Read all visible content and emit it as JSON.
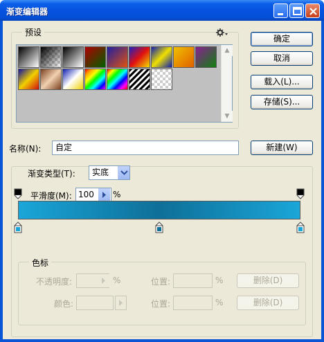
{
  "window": {
    "title": "渐变编辑器"
  },
  "presets": {
    "label": "预设",
    "gear_icon": "gear-icon",
    "swatches": [
      {
        "gradient": "linear-gradient(135deg,#000 0%,#fff 100%)"
      },
      {
        "gradient": "linear-gradient(135deg,#000 0%,rgba(0,0,0,0) 100%)",
        "checker": true
      },
      {
        "gradient": "linear-gradient(135deg,#000 0%,#fff 100%)"
      },
      {
        "gradient": "linear-gradient(135deg,#b00000 0%,#006000 100%)"
      },
      {
        "gradient": "linear-gradient(135deg,#2020a0 0%,#e05010 100%)"
      },
      {
        "gradient": "linear-gradient(135deg,#2020c0 0%,#e01010 50%,#f0e000 100%)"
      },
      {
        "gradient": "linear-gradient(135deg,#1020b0 0%,#f0e000 50%,#1020b0 100%)"
      },
      {
        "gradient": "linear-gradient(135deg,#f0c000 0%,#e06000 100%)"
      },
      {
        "gradient": "linear-gradient(135deg,#8a2090 0%,#108010 100%)"
      },
      {
        "gradient": "linear-gradient(135deg,#1010a0 0%,#f0d000 50%,#d01010 100%)"
      },
      {
        "gradient": "linear-gradient(135deg,#7a4020 0%,#f0d0b0 50%,#7a4020 100%)"
      },
      {
        "gradient": "linear-gradient(135deg,#1020b0 0%,#ffffff 50%,#f0d000 100%)"
      },
      {
        "gradient": "linear-gradient(135deg,red,orange,yellow,lime,cyan,blue,magenta)"
      },
      {
        "gradient": "linear-gradient(135deg,red,yellow,lime,cyan,blue,magenta,red)"
      },
      {
        "gradient": "repeating-linear-gradient(135deg,#000 0 3px,#fff 3px 6px)"
      },
      {
        "gradient": "none",
        "checker": true
      }
    ]
  },
  "buttons": {
    "ok": "确定",
    "cancel": "取消",
    "load": "载入(L)...",
    "save": "存储(S)...",
    "new": "新建(W)"
  },
  "name": {
    "label": "名称(N):",
    "value": "自定"
  },
  "gradient_type": {
    "label": "渐变类型(T):",
    "value": "实底"
  },
  "smoothness": {
    "label": "平滑度(M):",
    "value": "100",
    "unit": "%"
  },
  "gradient_bar": {
    "colors": [
      "#1aa6d9",
      "#0e6f98",
      "#1aa6d9"
    ],
    "color_stop_positions": [
      0,
      50,
      100
    ],
    "opacity_stop_positions": [
      0,
      100
    ]
  },
  "color_stops_section": {
    "label": "色标",
    "opacity_label": "不透明度:",
    "opacity_unit": "%",
    "location_label": "位置:",
    "location_unit": "%",
    "delete_label": "删除(D)",
    "color_label": "颜色:"
  }
}
